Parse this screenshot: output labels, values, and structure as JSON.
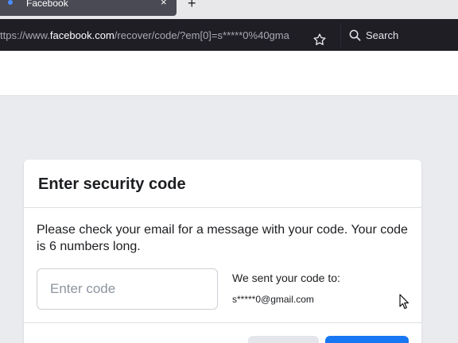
{
  "browser": {
    "tab_title": "Facebook",
    "tab_close": "×",
    "new_tab": "+",
    "url_prefix": "ttps://www.",
    "url_host": "facebook.com",
    "url_path": "/recover/code/?em[0]=s*****0%40gma",
    "search_label": "Search"
  },
  "card": {
    "title": "Enter security code",
    "instructions": "Please check your email for a message with your code. Your code is 6 numbers long.",
    "code_placeholder": "Enter code",
    "sent_label": "We sent your code to:",
    "sent_email": "s*****0@gmail.com"
  },
  "colors": {
    "primary": "#1877f2",
    "page_bg": "#e9ebee",
    "browser_dark": "#1f1e25"
  }
}
